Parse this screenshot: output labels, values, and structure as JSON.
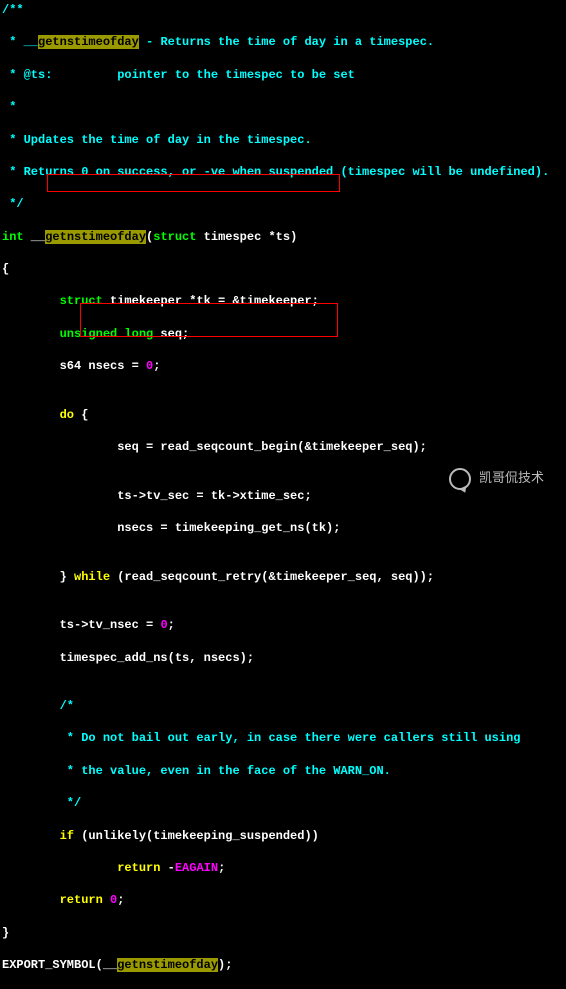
{
  "comment": {
    "l1": "/**",
    "l2_pre": " * __",
    "l2_hl": "getnstimeofday",
    "l2_post": " - Returns the time of day in a timespec.",
    "l3": " * @ts:         pointer to the timespec to be set",
    "l4": " *",
    "l5": " * Updates the time of day in the timespec.",
    "l6": " * Returns 0 on success, or -ve when suspended (timespec will be undefined).",
    "l7": " */"
  },
  "sig": {
    "int": "int",
    "space": " __",
    "name": "getnstimeofday",
    "paren_open": "(",
    "struct_kw": "struct",
    "rest": " timespec *ts)"
  },
  "brace_open": "{",
  "decl1": {
    "indent": "        ",
    "struct_kw": "struct",
    "rest": " timekeeper *tk = &timekeeper;"
  },
  "decl2": {
    "indent": "        ",
    "unsigned_kw": "unsigned long",
    "rest": " seq;"
  },
  "decl3": {
    "indent": "        s64 nsecs = ",
    "zero": "0",
    "semi": ";"
  },
  "blank": "",
  "do_open": {
    "indent": "        ",
    "do_kw": "do",
    "rest": " {"
  },
  "seq_line": "                seq = read_seqcount_begin(&timekeeper_seq);",
  "tvsec_line": "                ts->tv_sec = tk->xtime_sec;",
  "nsecs_line": "                nsecs = timekeeping_get_ns(tk);",
  "while_line": {
    "indent": "        } ",
    "while_kw": "while",
    "rest": " (read_seqcount_retry(&timekeeper_seq, seq));"
  },
  "tvnsec": {
    "pre": "        ts->tv_nsec = ",
    "zero": "0",
    "semi": ";"
  },
  "addns": "        timespec_add_ns(ts, nsecs);",
  "comment2": {
    "l1": "        /*",
    "l2": "         * Do not bail out early, in case there were callers still using",
    "l3": "         * the value, even in the face of the WARN_ON.",
    "l4": "         */"
  },
  "if_line": {
    "indent": "        ",
    "if_kw": "if",
    "rest": " (unlikely(timekeeping_suspended))"
  },
  "ret_eagain": {
    "indent": "                ",
    "return_kw": "return",
    "dash": " -",
    "eagain": "EAGAIN",
    "semi": ";"
  },
  "ret_zero": {
    "indent": "        ",
    "return_kw": "return",
    "space": " ",
    "zero": "0",
    "semi": ";"
  },
  "brace_close": "}",
  "export": {
    "pre": "EXPORT_SYMBOL(__",
    "hl": "getnstimeofday",
    "post": ");"
  },
  "watermark_text": "凯哥侃技术"
}
